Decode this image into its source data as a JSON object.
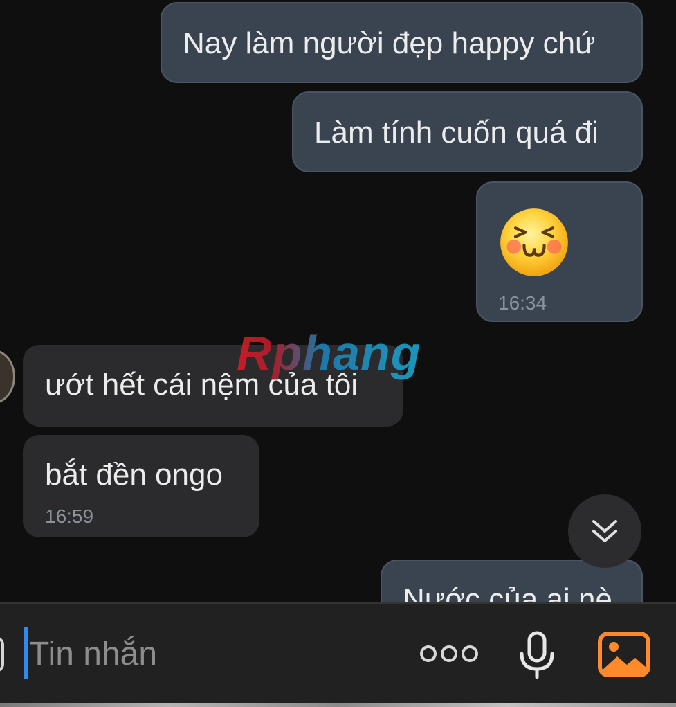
{
  "messages": [
    {
      "direction": "outgoing",
      "text": "Nay làm người đẹp happy chứ"
    },
    {
      "direction": "outgoing",
      "text": "Làm tính cuốn quá đi"
    },
    {
      "direction": "outgoing",
      "type": "sticker",
      "icon": "squinting-smile-emoji",
      "time": "16:34"
    },
    {
      "direction": "incoming",
      "text": "ướt hết cái nệm của tôi"
    },
    {
      "direction": "incoming",
      "text": "bắt đền ongo",
      "time": "16:59"
    },
    {
      "direction": "outgoing",
      "text": "Nước của ai nè"
    }
  ],
  "watermark": "Rphang",
  "scroll_down_icon": "double-chevron-down-icon",
  "composer": {
    "placeholder": "Tin nhắn",
    "more_icon": "more-dots-icon",
    "mic_icon": "microphone-icon",
    "image_icon": "image-gallery-icon"
  },
  "colors": {
    "background": "#0f0f10",
    "outgoing_bubble": "#3a4350",
    "incoming_bubble": "#2b2b2d",
    "image_button_accent": "#ff8a2b",
    "caret": "#2d8bf2"
  }
}
